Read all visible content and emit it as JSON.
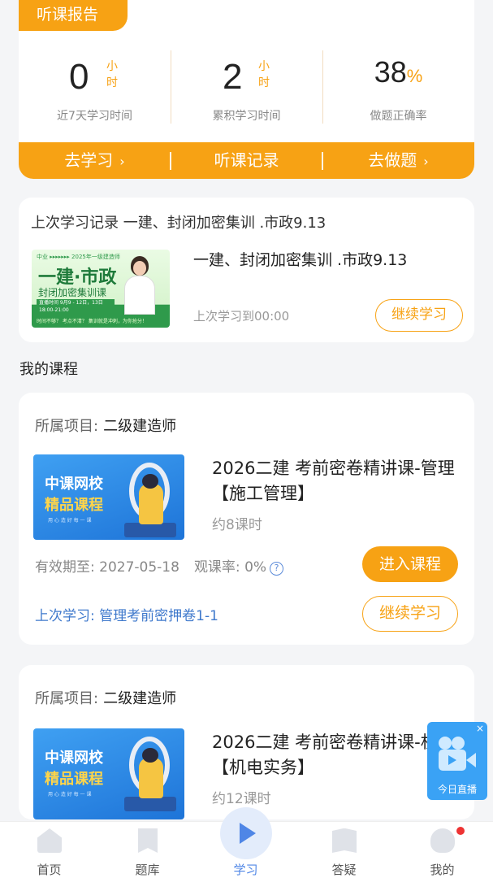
{
  "report": {
    "tag": "听课报告",
    "stats": [
      {
        "value": "0",
        "unit": "小时",
        "label": "近7天学习时间"
      },
      {
        "value": "2",
        "unit": "小时",
        "label": "累积学习时间"
      },
      {
        "value": "38",
        "unit": "%",
        "label": "做题正确率"
      }
    ],
    "actions": [
      {
        "label": "去学习",
        "chevron": "›"
      },
      {
        "label": "听课记录",
        "chevron": ""
      },
      {
        "label": "去做题",
        "chevron": "›"
      }
    ]
  },
  "last_study": {
    "title": "上次学习记录   一建、封闭加密集训 .市政9.13",
    "course_name": "一建、封闭加密集训 .市政9.13",
    "progress": "上次学习到00:00",
    "button": "继续学习",
    "thumb": {
      "header": "中业 ▸▸▸▸▸▸▸ 2025年一级建造师",
      "big": "一建·市政",
      "sub": "封闭加密集训课",
      "bar": "直播时间  9月9 - 12日，13日 18:00-21:00",
      "foot": "时间不够？ 考点不清？ 集训就是冲刺，为你抢分！"
    }
  },
  "section_title": "我的课程",
  "courses": [
    {
      "project_label": "所属项目:",
      "project": "二级建造师",
      "title": "2026二建 考前密卷精讲课-管理【施工管理】",
      "hours": "约8课时",
      "expiry": "有效期至: 2027-05-18",
      "watch_rate": "观课率: 0%",
      "enter_button": "进入课程",
      "last": "上次学习: 管理考前密押卷1-1",
      "continue_button": "继续学习",
      "thumb": {
        "line1": "中课网校",
        "line2": "精品课程",
        "line3": "用 心 造 好 每 一 课"
      }
    },
    {
      "project_label": "所属项目:",
      "project": "二级建造师",
      "title": "2026二建 考前密卷精讲课-机电【机电实务】",
      "hours": "约12课时",
      "thumb": {
        "line1": "中课网校",
        "line2": "精品课程",
        "line3": "用 心 造 好 每 一 课"
      }
    }
  ],
  "live": {
    "label": "今日直播",
    "close": "×"
  },
  "nav": {
    "items": [
      {
        "label": "首页",
        "icon": "home-icon"
      },
      {
        "label": "题库",
        "icon": "bookmark-icon"
      },
      {
        "label": "学习",
        "icon": "play-icon"
      },
      {
        "label": "答疑",
        "icon": "book-icon"
      },
      {
        "label": "我的",
        "icon": "profile-icon"
      }
    ]
  },
  "colors": {
    "accent": "#f7a214",
    "link": "#3f79cc",
    "nav_active": "#4f86e6",
    "live": "#3aa2f5"
  }
}
